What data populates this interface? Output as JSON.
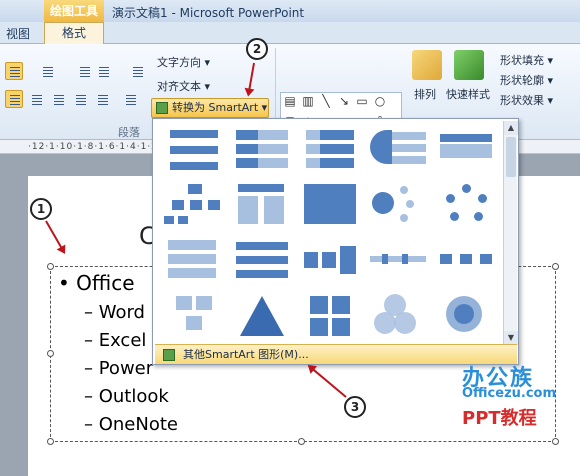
{
  "titlebar": {
    "context_group": "绘图工具",
    "title": "演示文稿1 - Microsoft PowerPoint"
  },
  "tabs": [
    {
      "label": "视图"
    },
    {
      "label": "格式"
    }
  ],
  "ribbon": {
    "text_direction": "文字方向 ▾",
    "align_text": "对齐文本 ▾",
    "convert_smartart": "转换为 SmartArt ▾",
    "paragraph_group": "段落",
    "arrange": "排列",
    "quick_styles": "快速样式",
    "shape_fill": "形状填充 ▾",
    "shape_outline": "形状轮廓 ▾",
    "shape_effects": "形状效果 ▾"
  },
  "ruler": "·12·1·10·1·8·1·6·1·4·1·2·1·0·1·2·1·4·1·6·1·8·1·10·1·12·",
  "slide": {
    "title_fragment": "C",
    "bullet": "• Office",
    "items": [
      "– Word",
      "– Excel",
      "– Power",
      "– Outlook",
      "– OneNote"
    ]
  },
  "popup": {
    "more": "其他SmartArt 图形(M)..."
  },
  "callouts": [
    "1",
    "2",
    "3"
  ],
  "watermark": {
    "line1": "办公族",
    "line2": "Officezu.com",
    "line3": "PPT教程"
  }
}
